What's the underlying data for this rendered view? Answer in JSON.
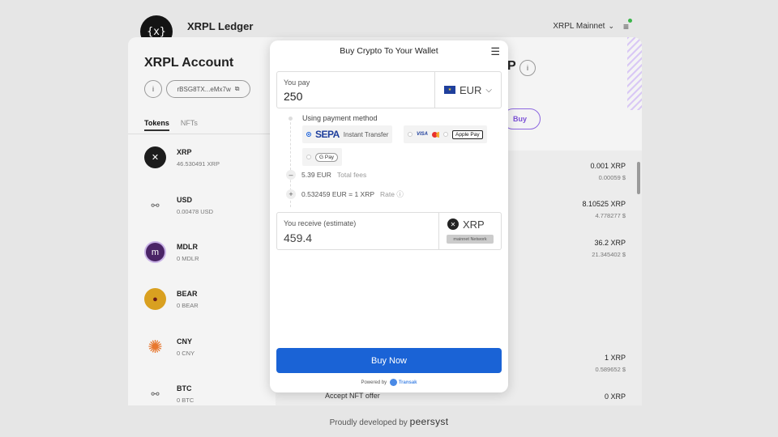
{
  "header": {
    "logo_text": "{x}",
    "brand": "XRPL Ledger",
    "network": "XRPL Mainnet"
  },
  "account": {
    "title": "XRPL Account",
    "address": "rBSG8TX...eMx7w",
    "tabs": [
      "Tokens",
      "NFTs"
    ],
    "tokens": [
      {
        "name": "XRP",
        "balance": "46.530491 XRP",
        "icon": "xrp-icon",
        "amount": "0.001 XRP",
        "fiat": "0.00059 $"
      },
      {
        "name": "USD",
        "balance": "0.00478 USD",
        "icon": "trustline-icon",
        "amount": "8.10525 XRP",
        "fiat": "4.778277 $"
      },
      {
        "name": "MDLR",
        "balance": "0 MDLR",
        "icon": "mdlr-icon",
        "amount": "36.2 XRP",
        "fiat": "21.345402 $"
      },
      {
        "name": "BEAR",
        "balance": "0 BEAR",
        "icon": "bear-icon"
      },
      {
        "name": "CNY",
        "balance": "0 CNY",
        "icon": "cny-icon",
        "amount": "1 XRP",
        "fiat": "0.589652 $"
      },
      {
        "name": "BTC",
        "balance": "0 BTC",
        "icon": "trustline-icon",
        "amount": "0 XRP"
      }
    ],
    "buy_label": "Buy",
    "nft_offer": "Accept NFT offer",
    "peek_letter": "P"
  },
  "footer": {
    "text": "Proudly developed by",
    "brand": "peersyst"
  },
  "modal": {
    "title": "Buy Crypto To Your Wallet",
    "pay_label": "You pay",
    "pay_value": "250",
    "pay_currency": "EUR",
    "method_label": "Using payment method",
    "methods": [
      {
        "name": "SEPA",
        "detail": "Instant Transfer",
        "selected": true
      },
      {
        "name": "VISA",
        "detail": "",
        "selected": false
      },
      {
        "name": "Apple Pay",
        "detail": "",
        "selected": false
      },
      {
        "name": "G Pay",
        "detail": "",
        "selected": false
      }
    ],
    "fees_value": "5.39 EUR",
    "fees_label": "Total fees",
    "rate_value": "0.532459 EUR = 1 XRP",
    "rate_label": "Rate",
    "receive_label": "You receive (estimate)",
    "receive_value": "459.4",
    "receive_currency": "XRP",
    "receive_network": "mainnet Network",
    "buy_button": "Buy Now",
    "powered_by": "Powered by",
    "provider": "Transak"
  },
  "colors": {
    "primary_button": "#1a63d6",
    "accent_purple": "#7a4fd6",
    "status_green": "#3bb54a"
  }
}
